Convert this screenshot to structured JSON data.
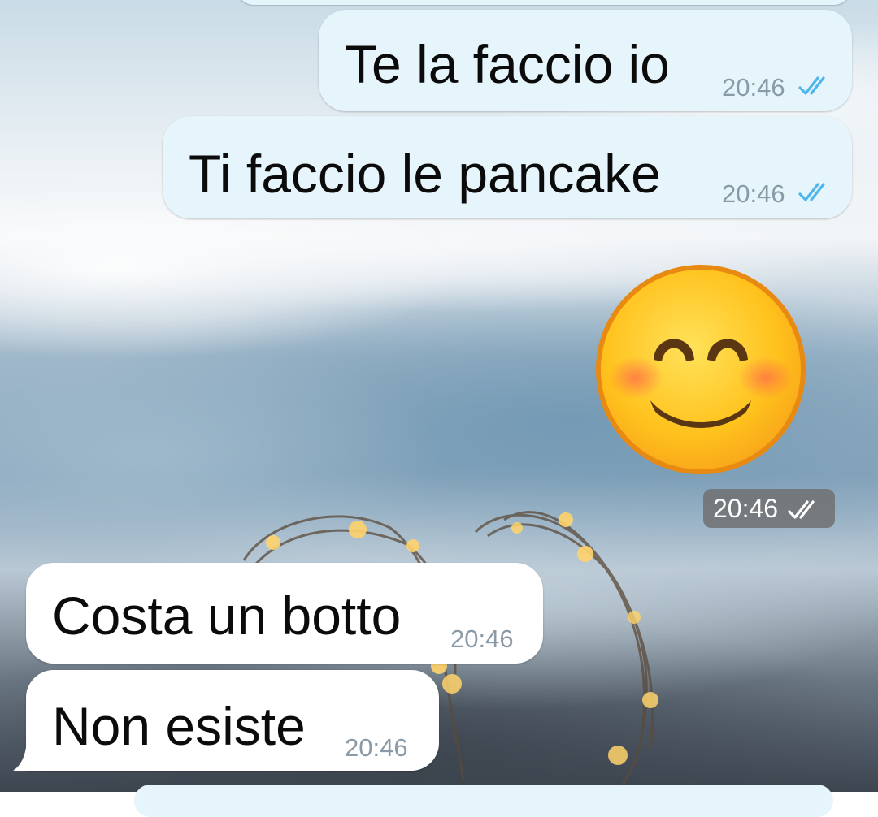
{
  "chat": {
    "messages": [
      {
        "direction": "outgoing",
        "text": "Te la faccio io",
        "time": "20:46",
        "status": "read"
      },
      {
        "direction": "outgoing",
        "text": "Ti faccio le pancake",
        "time": "20:46",
        "status": "read"
      },
      {
        "direction": "outgoing",
        "type": "emoji",
        "emoji": "smiling-face-with-smiling-eyes",
        "time": "20:46",
        "status": "read"
      },
      {
        "direction": "incoming",
        "text": "Costa un botto",
        "time": "20:46"
      },
      {
        "direction": "incoming",
        "text": "Non esiste",
        "time": "20:46"
      }
    ]
  },
  "theme": {
    "outgoing_bubble": "#e6f5fb",
    "incoming_bubble": "#ffffff",
    "tick_color": "#4fb6ec",
    "time_color": "#8a9aa6",
    "emoji_face": "#ffc21d",
    "emoji_outline": "#e88a12"
  }
}
